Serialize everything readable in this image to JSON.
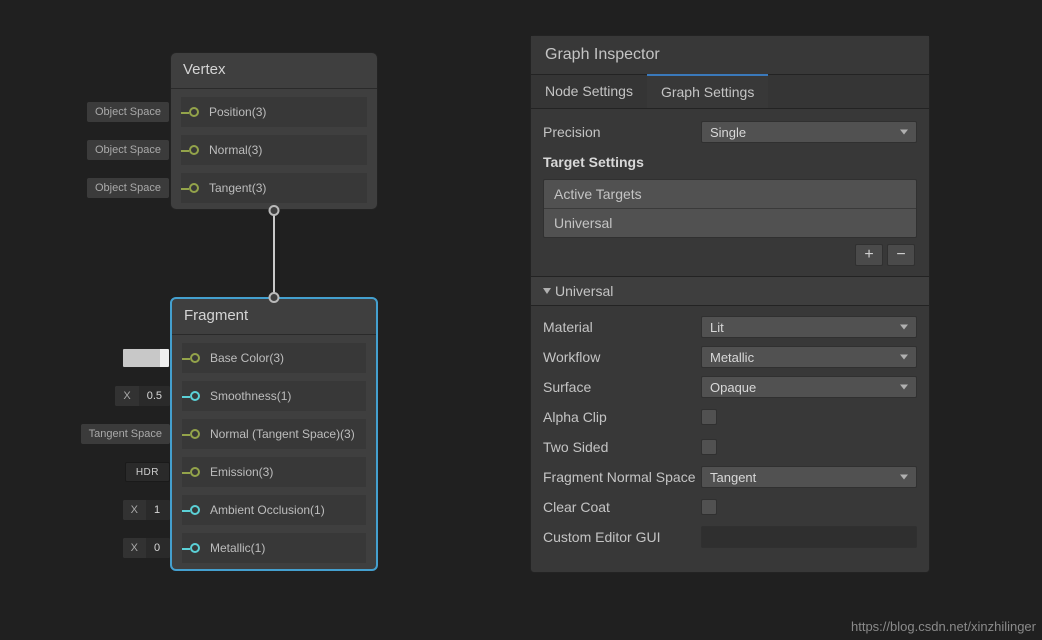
{
  "graph": {
    "vertex": {
      "title": "Vertex",
      "rows": [
        {
          "chip": "Object Space",
          "label": "Position(3)"
        },
        {
          "chip": "Object Space",
          "label": "Normal(3)"
        },
        {
          "chip": "Object Space",
          "label": "Tangent(3)"
        }
      ]
    },
    "fragment": {
      "title": "Fragment",
      "rows": [
        {
          "chipType": "swatch",
          "chip": "",
          "label": "Base Color(3)"
        },
        {
          "chipType": "x",
          "chipX": "X",
          "chipV": "0.5",
          "label": "Smoothness(1)"
        },
        {
          "chipType": "text",
          "chip": "Tangent Space",
          "label": "Normal (Tangent Space)(3)"
        },
        {
          "chipType": "hdr",
          "chip": "HDR",
          "label": "Emission(3)"
        },
        {
          "chipType": "x",
          "chipX": "X",
          "chipV": "1",
          "label": "Ambient Occlusion(1)"
        },
        {
          "chipType": "x",
          "chipX": "X",
          "chipV": "0",
          "label": "Metallic(1)"
        }
      ]
    }
  },
  "inspector": {
    "title": "Graph Inspector",
    "tabs": {
      "node": "Node Settings",
      "graph": "Graph Settings"
    },
    "precision": {
      "label": "Precision",
      "value": "Single"
    },
    "targetSettingsHeader": "Target Settings",
    "activeTargets": {
      "header": "Active Targets",
      "items": [
        "Universal"
      ]
    },
    "addGlyph": "+",
    "removeGlyph": "−",
    "foldout": "Universal",
    "material": {
      "label": "Material",
      "value": "Lit"
    },
    "workflow": {
      "label": "Workflow",
      "value": "Metallic"
    },
    "surface": {
      "label": "Surface",
      "value": "Opaque"
    },
    "alphaClip": {
      "label": "Alpha Clip"
    },
    "twoSided": {
      "label": "Two Sided"
    },
    "fragNormal": {
      "label": "Fragment Normal Space",
      "value": "Tangent"
    },
    "clearCoat": {
      "label": "Clear Coat"
    },
    "customGUI": {
      "label": "Custom Editor GUI",
      "value": ""
    }
  },
  "watermark": "https://blog.csdn.net/xinzhilinger"
}
